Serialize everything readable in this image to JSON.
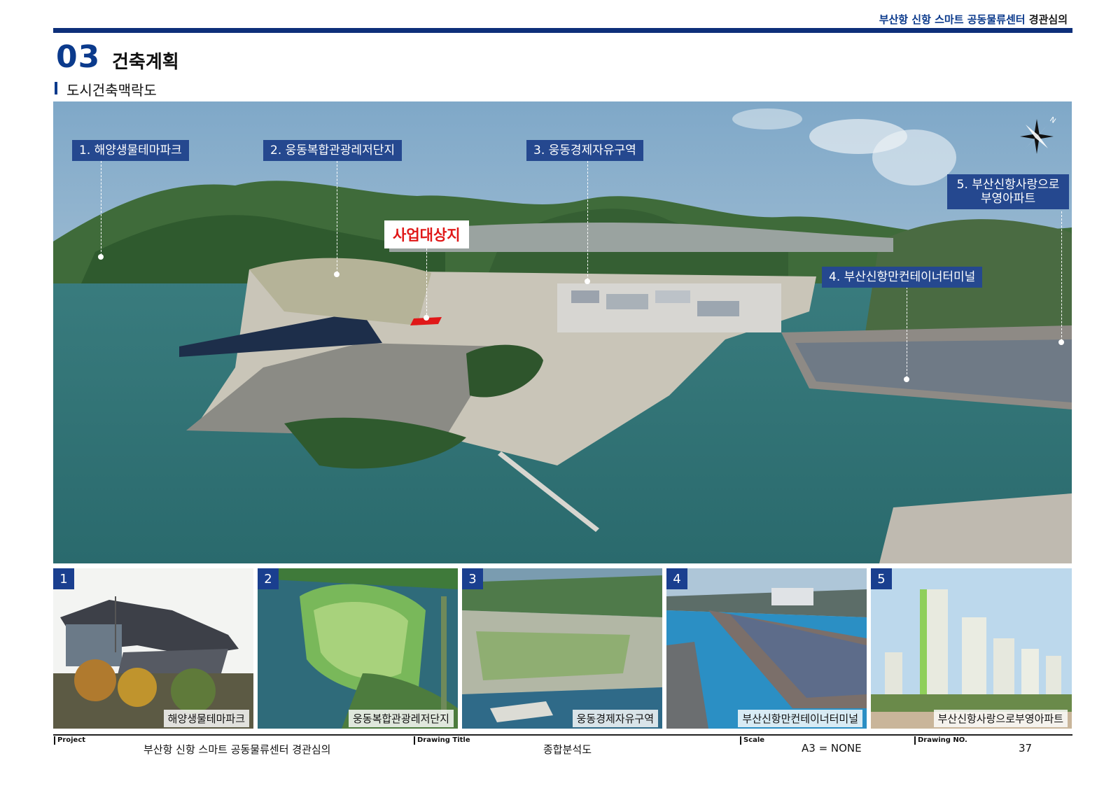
{
  "header": {
    "project_blue": "부산항 신항 스마트 공동물류센터",
    "project_dark": "경관심의"
  },
  "section": {
    "number": "03",
    "title": "건축계획",
    "subtitle": "도시건축맥락도"
  },
  "map": {
    "callouts": [
      "1. 해양생물테마파크",
      "2. 웅동복합관광레저단지",
      "3. 웅동경제자유구역",
      "4. 부산신항만컨테이너터미널",
      "5. 부산신항사랑으로\n부영아파트"
    ],
    "site_label": "사업대상지",
    "compass_icon": "north-arrow-icon"
  },
  "photos": [
    {
      "num": "1",
      "caption": "해양생물테마파크"
    },
    {
      "num": "2",
      "caption": "웅동복합관광레저단지"
    },
    {
      "num": "3",
      "caption": "웅동경제자유구역"
    },
    {
      "num": "4",
      "caption": "부산신항만컨테이너터미널"
    },
    {
      "num": "5",
      "caption": "부산신항사랑으로부영아파트"
    }
  ],
  "footer": {
    "project_label": "Project",
    "project_value": "부산항 신항 스마트 공동물류센터 경관심의",
    "drawing_title_label": "Drawing Title",
    "drawing_title_value": "종합분석도",
    "scale_label": "Scale",
    "scale_value": "A3 = NONE",
    "drawing_no_label": "Drawing NO.",
    "drawing_no_value": "37"
  },
  "colors": {
    "accent": "#0b3a8c",
    "callout_bg": "#25488f",
    "site_red": "#e01818"
  }
}
